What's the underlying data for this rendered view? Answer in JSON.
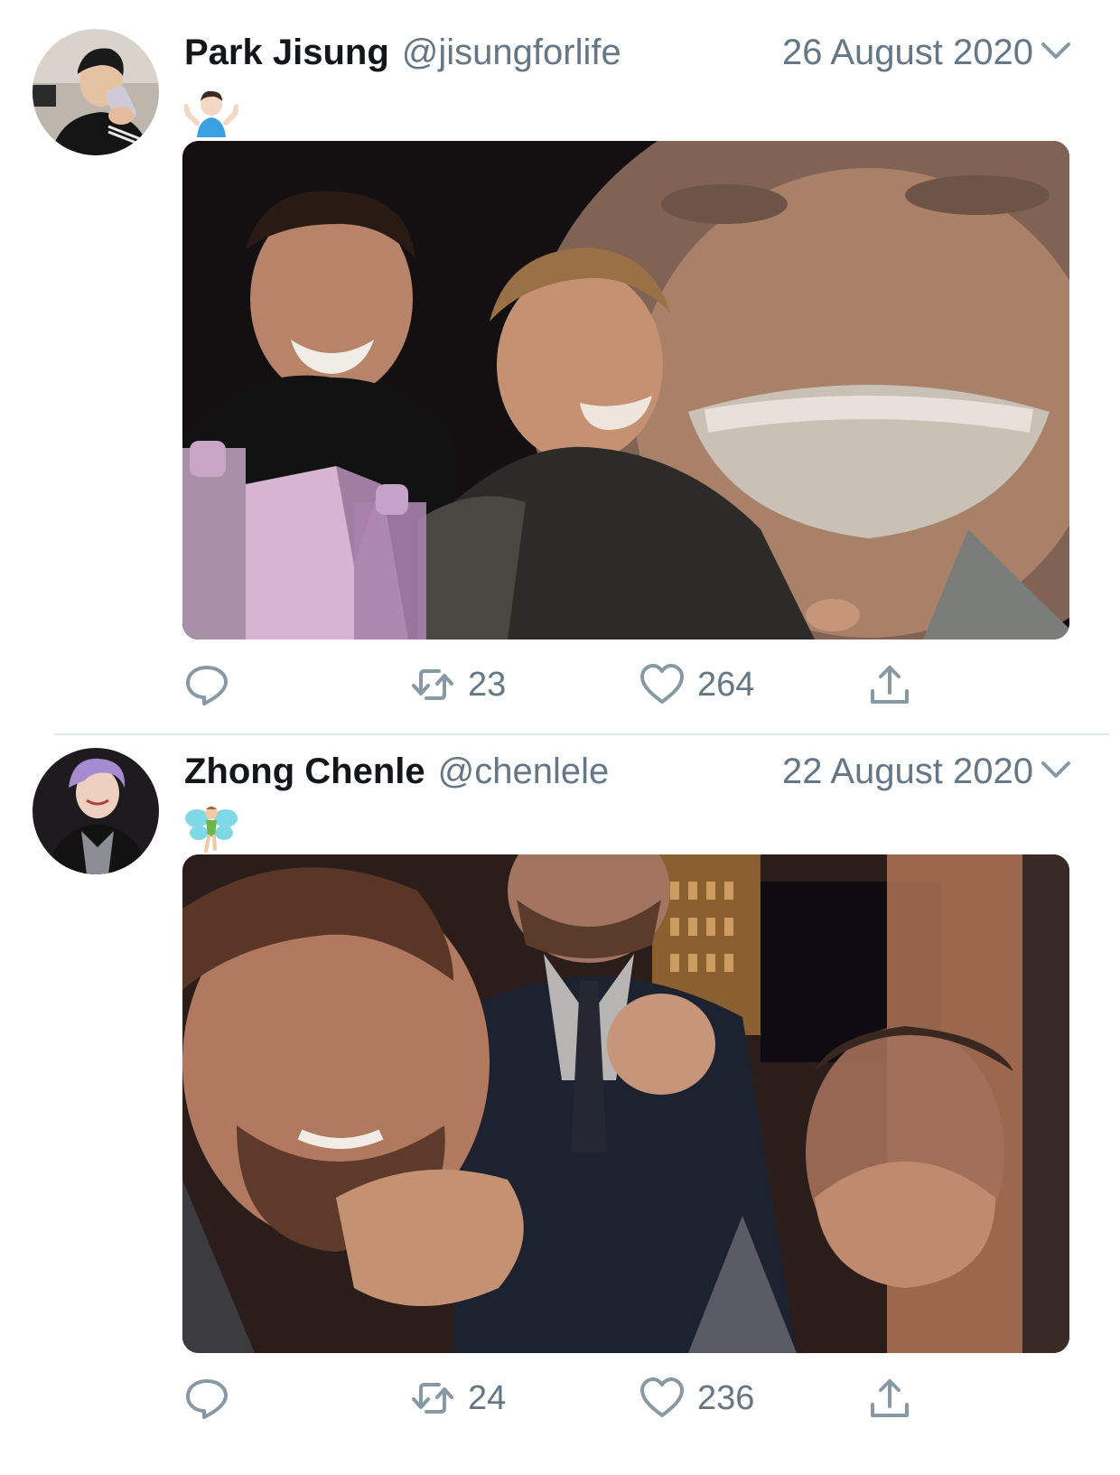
{
  "tweets": [
    {
      "display_name": "Park Jisung",
      "handle": "@jisungforlife",
      "date": "26 August 2020",
      "emoji_icon": "person-shrugging-emoji",
      "media_description_icon": "photo-media",
      "actions": {
        "reply_count": "",
        "retweet_count": "23",
        "like_count": "264"
      }
    },
    {
      "display_name": "Zhong Chenle",
      "handle": "@chenlele",
      "date": "22 August 2020",
      "emoji_icon": "fairy-emoji",
      "media_description_icon": "photo-media",
      "actions": {
        "reply_count": "",
        "retweet_count": "24",
        "like_count": "236"
      }
    }
  ],
  "colors": {
    "secondary_text": "#657786",
    "primary_text": "#14171a",
    "divider": "#e1e8ed"
  }
}
